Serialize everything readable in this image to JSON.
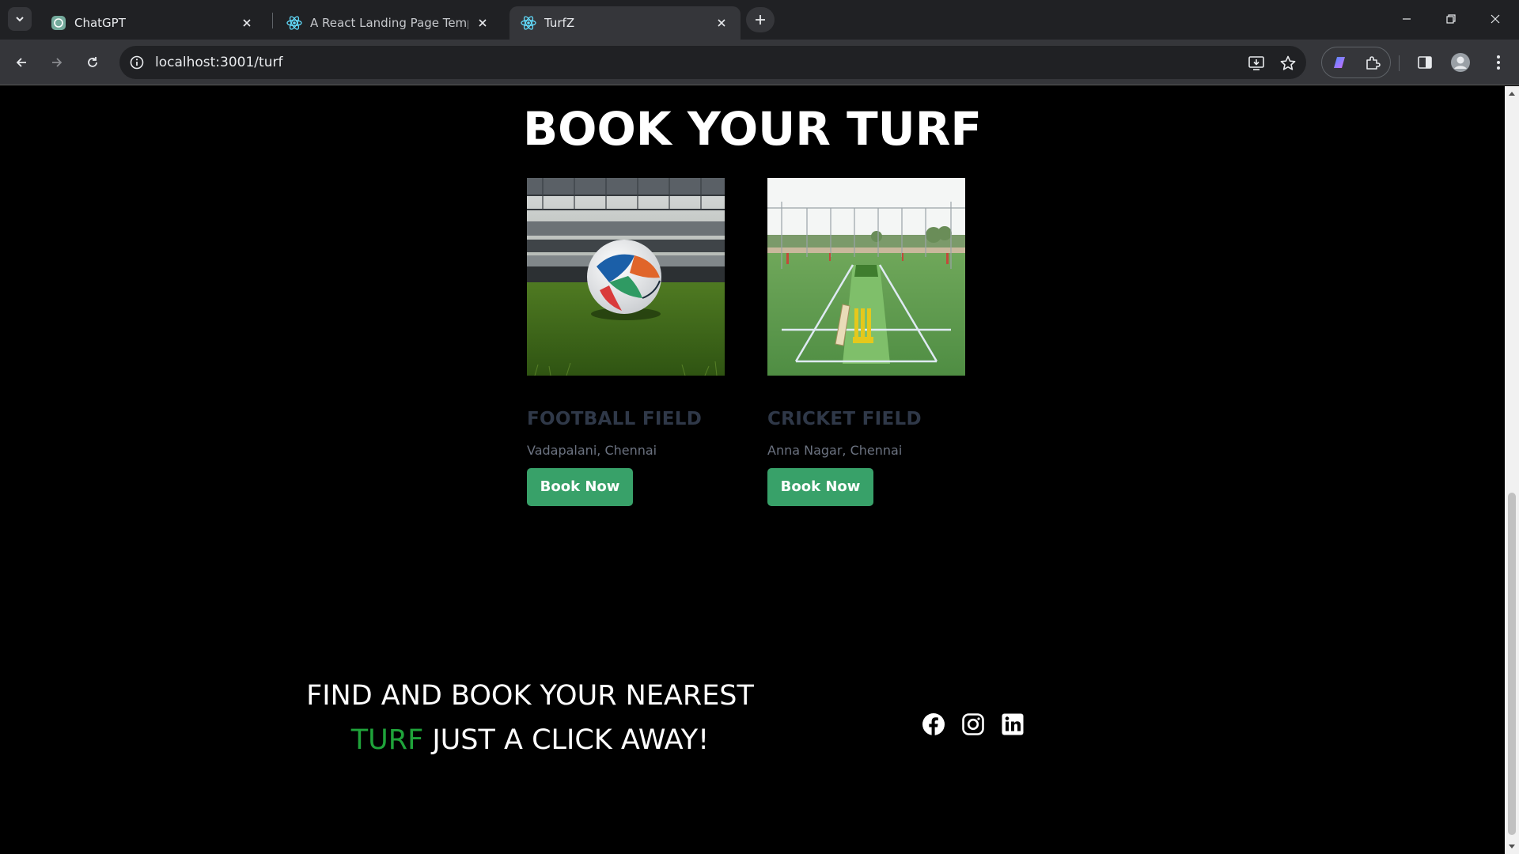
{
  "browser": {
    "tabs": [
      {
        "title": "ChatGPT",
        "active": false
      },
      {
        "title": "A React Landing Page Templat",
        "active": false
      },
      {
        "title": "TurfZ",
        "active": true
      }
    ],
    "url": "localhost:3001/turf"
  },
  "page": {
    "heading": "BOOK YOUR TURF",
    "cards": [
      {
        "name": "FOOTBALL FIELD",
        "location": "Vadapalani, Chennai",
        "button": "Book Now"
      },
      {
        "name": "CRICKET FIELD",
        "location": "Anna Nagar, Chennai",
        "button": "Book Now"
      }
    ],
    "tagline": {
      "line1": "FIND AND BOOK YOUR NEAREST",
      "highlight": "TURF",
      "rest": " JUST A CLICK AWAY!"
    },
    "social": [
      "facebook-icon",
      "instagram-icon",
      "linkedin-icon"
    ]
  },
  "colors": {
    "accent_green": "#38a169",
    "highlight_green": "#1fa33a",
    "card_title": "#2f3848",
    "background": "#000000"
  }
}
